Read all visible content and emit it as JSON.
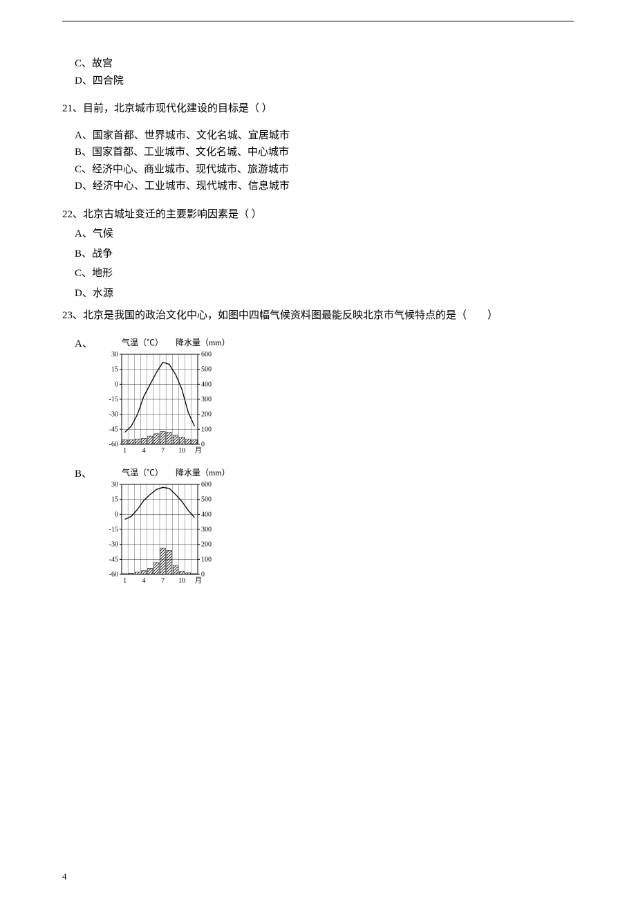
{
  "prior_options": {
    "c": "C、故宫",
    "d": "D、四合院"
  },
  "q21": {
    "stem": "21、目前，北京城市现代化建设的目标是（ ）",
    "a": "A、国家首都、世界城市、文化名城、宜居城市",
    "b": "B、国家首都、工业城市、文化名城、中心城市",
    "c": "C、经济中心、商业城市、现代城市、旅游城市",
    "d": "D、经济中心、工业城市、现代城市、信息城市"
  },
  "q22": {
    "stem": "22、北京古城址变迁的主要影响因素是（ ）",
    "a": "A、气候",
    "b": "B、战争",
    "c": "C、地形",
    "d": "D、水源"
  },
  "q23": {
    "stem": "23、北京是我国的政治文化中心，如图中四幅气候资料图最能反映北京市气候特点的是（　　）",
    "opt_a": "A、",
    "opt_b": "B、",
    "chart_titles": {
      "temp": "气温（℃）",
      "precip": "降水量（mm）"
    }
  },
  "page_number": "4",
  "chart_data": [
    {
      "id": "q23-A",
      "type": "combo",
      "title": "",
      "xlabel": "月",
      "x_categories": [
        1,
        2,
        3,
        4,
        5,
        6,
        7,
        8,
        9,
        10,
        11,
        12
      ],
      "x_ticks_shown": [
        1,
        4,
        7,
        10
      ],
      "left_axis": {
        "label": "气温（℃）",
        "ticks": [
          30,
          15,
          0,
          -15,
          -30,
          -45,
          -60
        ],
        "range": [
          -60,
          30
        ]
      },
      "right_axis": {
        "label": "降水量（mm）",
        "ticks": [
          600,
          500,
          400,
          300,
          200,
          100,
          0
        ],
        "range": [
          0,
          600
        ]
      },
      "series": [
        {
          "name": "气温",
          "type": "line",
          "axis": "left",
          "values": [
            -48,
            -42,
            -30,
            -12,
            0,
            12,
            22,
            20,
            10,
            -5,
            -28,
            -42
          ]
        },
        {
          "name": "降水量",
          "type": "bar",
          "axis": "right",
          "values": [
            30,
            30,
            35,
            40,
            55,
            70,
            85,
            80,
            60,
            45,
            35,
            30
          ]
        }
      ]
    },
    {
      "id": "q23-B",
      "type": "combo",
      "title": "",
      "xlabel": "月",
      "x_categories": [
        1,
        2,
        3,
        4,
        5,
        6,
        7,
        8,
        9,
        10,
        11,
        12
      ],
      "x_ticks_shown": [
        1,
        4,
        7,
        10
      ],
      "left_axis": {
        "label": "气温（℃）",
        "ticks": [
          30,
          15,
          0,
          -15,
          -30,
          -45,
          -60
        ],
        "range": [
          -60,
          30
        ]
      },
      "right_axis": {
        "label": "降水量（mm）",
        "ticks": [
          600,
          500,
          400,
          300,
          200,
          100,
          0
        ],
        "range": [
          0,
          600
        ]
      },
      "series": [
        {
          "name": "气温",
          "type": "line",
          "axis": "left",
          "values": [
            -5,
            -2,
            5,
            14,
            20,
            25,
            27,
            26,
            20,
            13,
            4,
            -3
          ]
        },
        {
          "name": "降水量",
          "type": "bar",
          "axis": "right",
          "values": [
            5,
            8,
            15,
            25,
            40,
            80,
            175,
            160,
            60,
            20,
            10,
            5
          ]
        }
      ]
    }
  ]
}
